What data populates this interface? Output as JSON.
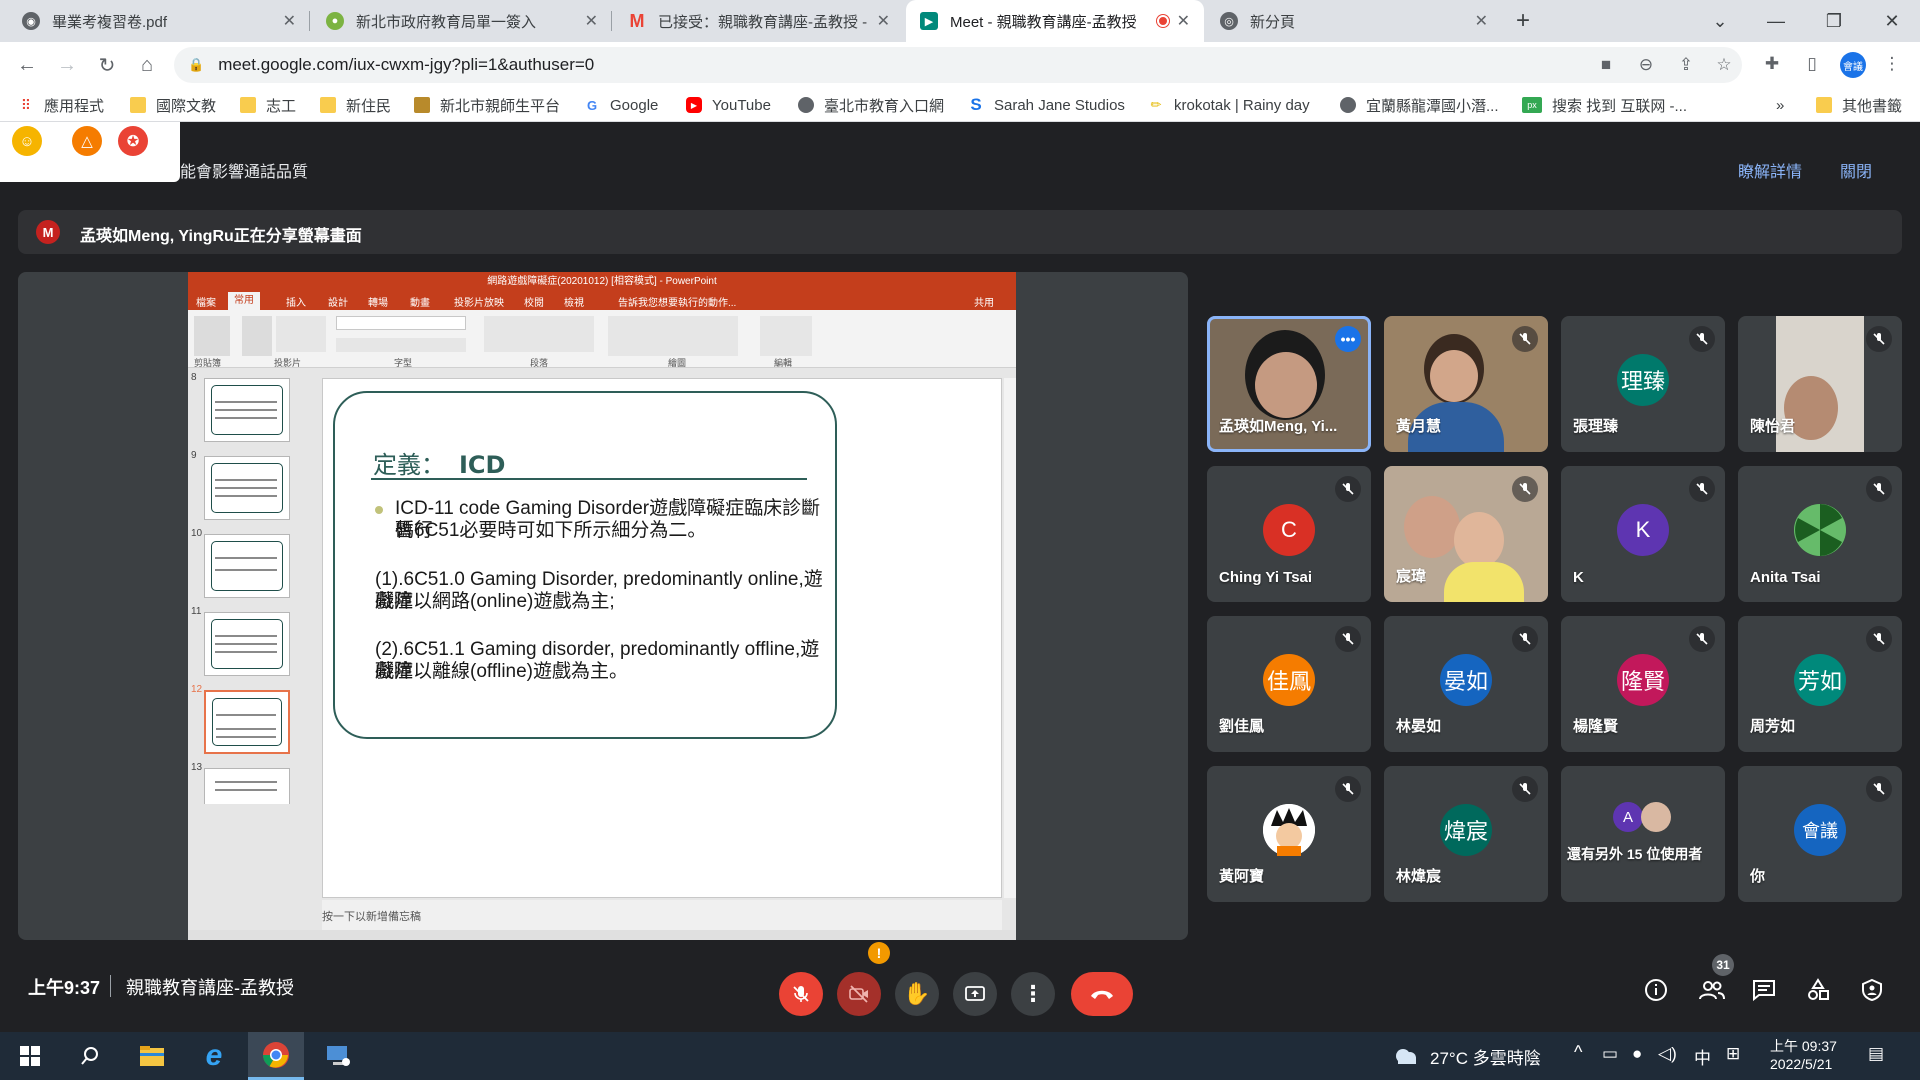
{
  "browser": {
    "tabs": [
      {
        "title": "畢業考複習卷.pdf",
        "icon": "globe-icon",
        "color": "#5f6368"
      },
      {
        "title": "新北市政府教育局單一簽入",
        "icon": "site-icon",
        "color": "#7cb342"
      },
      {
        "title": "已接受：親職教育講座-孟教授 -",
        "icon": "gmail-icon",
        "color": "#ea4335"
      },
      {
        "title": "Meet - 親職教育講座-孟教授",
        "icon": "meet-icon",
        "color": "#00897b"
      },
      {
        "title": "新分頁",
        "icon": "chrome-icon",
        "color": "#5f6368"
      }
    ],
    "url": "meet.google.com/iux-cwxm-jgy?pli=1&authuser=0",
    "profile_label": "會議",
    "bookmarks": [
      {
        "label": "應用程式",
        "icon": "apps-icon"
      },
      {
        "label": "國際文教",
        "icon": "folder-icon"
      },
      {
        "label": "志工",
        "icon": "folder-icon"
      },
      {
        "label": "新住民",
        "icon": "folder-icon"
      },
      {
        "label": "新北市親師生平台",
        "icon": "site-icon"
      },
      {
        "label": "Google",
        "icon": "google-icon"
      },
      {
        "label": "YouTube",
        "icon": "youtube-icon"
      },
      {
        "label": "臺北市教育入口網",
        "icon": "globe-icon"
      },
      {
        "label": "Sarah Jane Studios",
        "icon": "s-icon"
      },
      {
        "label": "krokotak | Rainy day",
        "icon": "pencil-icon"
      },
      {
        "label": "宜蘭縣龍潭國小潛...",
        "icon": "globe-icon"
      },
      {
        "label": "搜索 找到 互联网 -...",
        "icon": "px-icon"
      },
      {
        "label": "其他書籤",
        "icon": "folder-icon"
      }
    ]
  },
  "meet": {
    "warning_text": "能會影響通話品質",
    "warning_details": "瞭解詳情",
    "warning_close": "關閉",
    "share_avatar": "M",
    "share_text": "孟瑛如Meng, YingRu正在分享螢幕畫面",
    "time": "上午9:37",
    "meeting_title": "親職教育講座-孟教授",
    "people_count": "31",
    "alert": "!",
    "participants": [
      {
        "name": "孟瑛如Meng, Yi...",
        "initial": "",
        "video": true,
        "color": ""
      },
      {
        "name": "黃月慧",
        "initial": "",
        "video": true,
        "color": ""
      },
      {
        "name": "張理臻",
        "initial": "理臻",
        "video": false,
        "color": "#00796b"
      },
      {
        "name": "陳怡君",
        "initial": "",
        "video": true,
        "color": ""
      },
      {
        "name": "Ching Yi Tsai",
        "initial": "C",
        "video": false,
        "color": "#d93025"
      },
      {
        "name": "宸瑋",
        "initial": "",
        "video": true,
        "color": ""
      },
      {
        "name": "K",
        "initial": "K",
        "video": false,
        "color": "#5e35b1"
      },
      {
        "name": "Anita Tsai",
        "initial": "",
        "video": false,
        "color": "#43a047"
      },
      {
        "name": "劉佳鳳",
        "initial": "佳鳳",
        "video": false,
        "color": "#f57c00"
      },
      {
        "name": "林晏如",
        "initial": "晏如",
        "video": false,
        "color": "#1565c0"
      },
      {
        "name": "楊隆賢",
        "initial": "隆賢",
        "video": false,
        "color": "#c2185b"
      },
      {
        "name": "周芳如",
        "initial": "芳如",
        "video": false,
        "color": "#00897b"
      },
      {
        "name": "黃阿寶",
        "initial": "",
        "video": false,
        "color": "#ffffff"
      },
      {
        "name": "林煒宸",
        "initial": "煒宸",
        "video": false,
        "color": "#00695c"
      },
      {
        "name": "還有另外 15 位使用者",
        "initial": "A",
        "video": false,
        "color": "#5e35b1"
      },
      {
        "name": "你",
        "initial": "會議",
        "video": false,
        "color": "#1565c0"
      }
    ]
  },
  "ppt": {
    "window_title": "網路遊戲障礙症(20201012) [相容模式] - PowerPoint",
    "tabs": [
      "檔案",
      "常用",
      "插入",
      "設計",
      "轉場",
      "動畫",
      "投影片放映",
      "校閱",
      "檢視",
      "告訴我您想要執行的動作...",
      "共用"
    ],
    "ribbon_groups": [
      "剪貼簿",
      "投影片",
      "字型",
      "段落",
      "繪圖",
      "編輯"
    ],
    "thumb_numbers": [
      "8",
      "9",
      "10",
      "11",
      "12",
      "13"
    ],
    "notes_placeholder": "按一下以新增備忘稿",
    "slide": {
      "title_a": "定義：",
      "title_b": "ICD",
      "bullet": "ICD-11 code Gaming Disorder遊戲障礙症臨床診斷暫行碼6C51必要時可如下所示細分為二。",
      "bullet_line1": "ICD-11 code Gaming Disorder遊戲障礙症臨床診斷暫行",
      "bullet_line2": "碼6C51必要時可如下所示細分為二。",
      "item1_line1": "(1).6C51.0 Gaming Disorder, predominantly online,遊戲障",
      "item1_line2": "礙症以網路(online)遊戲為主;",
      "item2_line1": "(2).6C51.1 Gaming disorder, predominantly offline,遊戲障",
      "item2_line2": "礙症以離線(offline)遊戲為主。"
    }
  },
  "taskbar": {
    "weather": "27°C 多雲時陰",
    "ime": "中",
    "time": "上午 09:37",
    "date": "2022/5/21"
  }
}
